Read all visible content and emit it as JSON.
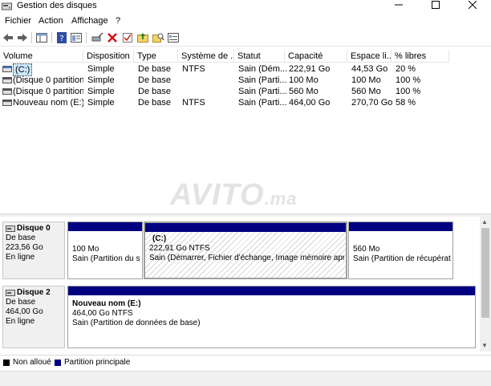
{
  "window": {
    "title": "Gestion des disques"
  },
  "menu": [
    "Fichier",
    "Action",
    "Affichage",
    "?"
  ],
  "table": {
    "columns": [
      "Volume",
      "Disposition",
      "Type",
      "Système de ...",
      "Statut",
      "Capacité",
      "Espace li...",
      "% libres"
    ],
    "rows": [
      [
        "(C:)",
        "Simple",
        "De base",
        "NTFS",
        "Sain (Dém...",
        "222,91 Go",
        "44,53 Go",
        "20 %"
      ],
      [
        "(Disque 0 partition...",
        "Simple",
        "De base",
        "",
        "Sain (Parti...",
        "100 Mo",
        "100 Mo",
        "100 %"
      ],
      [
        "(Disque 0 partition...",
        "Simple",
        "De base",
        "",
        "Sain (Parti...",
        "560 Mo",
        "560 Mo",
        "100 %"
      ],
      [
        "Nouveau nom (E:)",
        "Simple",
        "De base",
        "NTFS",
        "Sain (Parti...",
        "464,00 Go",
        "270,70 Go",
        "58 %"
      ]
    ]
  },
  "watermark": {
    "main": "AVITO",
    "suffix": ".ma"
  },
  "disks": [
    {
      "name": "Disque 0",
      "type": "De base",
      "size": "223,56 Go",
      "state": "En ligne",
      "partitions": [
        {
          "name": "",
          "size": "100 Mo",
          "status": "Sain (Partition du sys"
        },
        {
          "name": "(C:)",
          "size": "222,91 Go NTFS",
          "status": "Sain (Démarrer, Fichier d'échange, Image mémoire aprè"
        },
        {
          "name": "",
          "size": "560 Mo",
          "status": "Sain (Partition de récupérati"
        }
      ]
    },
    {
      "name": "Disque 2",
      "type": "De base",
      "size": "464,00 Go",
      "state": "En ligne",
      "partitions": [
        {
          "name": "Nouveau nom  (E:)",
          "size": "464,00 Go NTFS",
          "status": "Sain (Partition de données de base)"
        }
      ]
    }
  ],
  "legend": [
    {
      "label": "Non alloué",
      "color": "#000000"
    },
    {
      "label": "Partition principale",
      "color": "#000080"
    }
  ]
}
